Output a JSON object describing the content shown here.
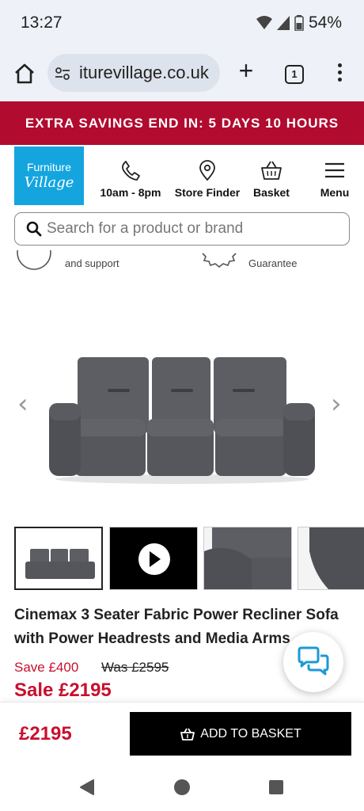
{
  "status": {
    "time": "13:27",
    "battery": "54%"
  },
  "browser": {
    "url": "iturevillage.co.uk",
    "tab_count": "1"
  },
  "promo": {
    "text": "EXTRA SAVINGS END IN: 5 DAYS 10 HOURS"
  },
  "header": {
    "logo_top": "Furniture",
    "logo_bottom": "Village",
    "hours": "10am - 8pm",
    "store_finder": "Store Finder",
    "basket": "Basket",
    "menu": "Menu"
  },
  "search": {
    "placeholder": "Search for a product or brand"
  },
  "usp": {
    "left": "and support",
    "right": "Guarantee"
  },
  "product": {
    "title": "Cinemax 3 Seater Fabric Power Recliner Sofa with Power Headrests and Media Arms",
    "save": "Save £400",
    "was": "Was £2595",
    "sale": "Sale £2195"
  },
  "bottom_bar": {
    "price": "£2195",
    "add_to_basket": "ADD TO BASKET"
  },
  "colors": {
    "accent": "#b10b2f",
    "price_red": "#c8102e",
    "logo_blue": "#14a5df",
    "sofa": "#55565c"
  }
}
